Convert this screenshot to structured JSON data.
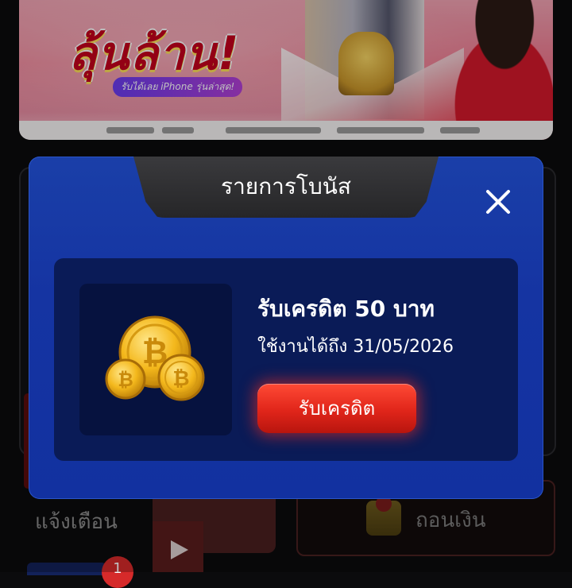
{
  "banner": {
    "headline": "ลุ้นล้าน!",
    "subline": "รับได้เลย iPhone รุ่นล่าสุด!"
  },
  "background": {
    "notify_label": "แจ้งเตือน",
    "withdraw_label": "ถอนเงิน",
    "notify_badge_count": "1"
  },
  "modal": {
    "title": "รายการโบนัส",
    "bonus": {
      "title": "รับเครดิต 50 บาท",
      "expiry": "ใช้งานได้ถึง 31/05/2026",
      "claim_label": "รับเครดิต",
      "icon": "bitcoin-coins-icon"
    },
    "close_icon": "close-icon"
  },
  "colors": {
    "modal_blue": "#1534a2",
    "card_navy": "#0a1b57",
    "claim_red": "#e0251a",
    "tab_gray": "#2f2f31"
  }
}
